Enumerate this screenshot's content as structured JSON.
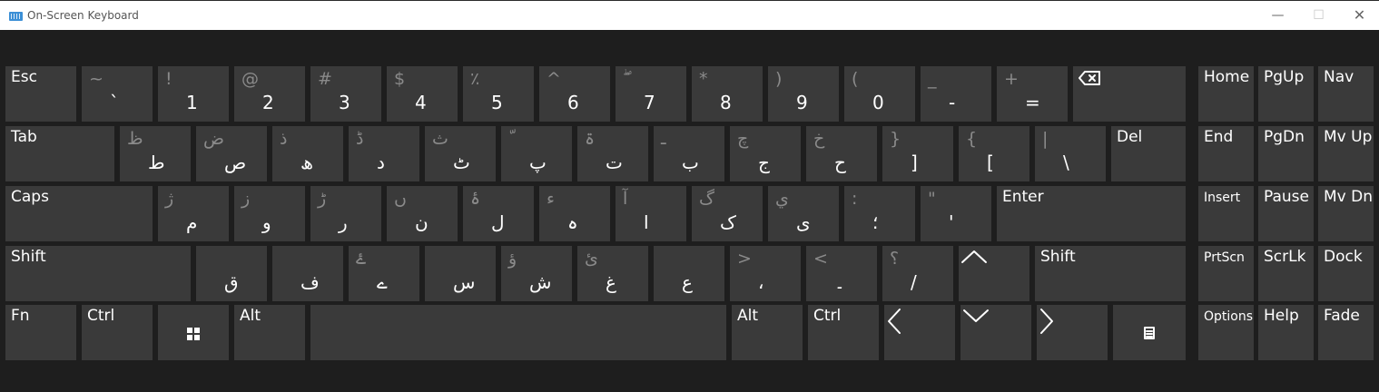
{
  "window": {
    "title": "On-Screen Keyboard",
    "keyboard_icon": "keyboard-icon",
    "minimize": "—",
    "maximize": "☐",
    "close": "✕"
  },
  "rows": [
    [
      {
        "id": "esc",
        "label": "Esc"
      },
      {
        "id": "grave",
        "main": "`",
        "shift": "~"
      },
      {
        "id": "1",
        "main": "1",
        "shift": "!"
      },
      {
        "id": "2",
        "main": "2",
        "shift": "@"
      },
      {
        "id": "3",
        "main": "3",
        "shift": "#"
      },
      {
        "id": "4",
        "main": "4",
        "shift": "$"
      },
      {
        "id": "5",
        "main": "5",
        "shift": "٪"
      },
      {
        "id": "6",
        "main": "6",
        "shift": "^"
      },
      {
        "id": "7",
        "main": "7",
        "shift": "ۖ"
      },
      {
        "id": "8",
        "main": "8",
        "shift": "*"
      },
      {
        "id": "9",
        "main": "9",
        "shift": ")"
      },
      {
        "id": "0",
        "main": "0",
        "shift": "("
      },
      {
        "id": "minus",
        "main": "-",
        "shift": "_"
      },
      {
        "id": "equals",
        "main": "=",
        "shift": "+"
      },
      {
        "id": "backspace",
        "icon": "backspace-icon"
      }
    ],
    [
      {
        "id": "tab",
        "label": "Tab"
      },
      {
        "id": "q",
        "main": "ط",
        "shift": "ظ"
      },
      {
        "id": "w",
        "main": "ص",
        "shift": "ض"
      },
      {
        "id": "e",
        "main": "ھ",
        "shift": "ذ"
      },
      {
        "id": "r",
        "main": "د",
        "shift": "ڈ"
      },
      {
        "id": "t",
        "main": "ٹ",
        "shift": "ث"
      },
      {
        "id": "y",
        "main": "پ",
        "shift": "ّ"
      },
      {
        "id": "u",
        "main": "ت",
        "shift": "ۃ"
      },
      {
        "id": "i",
        "main": "ب",
        "shift": "ـ"
      },
      {
        "id": "o",
        "main": "ج",
        "shift": "چ"
      },
      {
        "id": "p",
        "main": "ح",
        "shift": "خ"
      },
      {
        "id": "lbracket",
        "main": "]",
        "shift": "}"
      },
      {
        "id": "rbracket",
        "main": "[",
        "shift": "{"
      },
      {
        "id": "backslash",
        "main": "\\",
        "shift": "|"
      },
      {
        "id": "del",
        "label": "Del"
      }
    ],
    [
      {
        "id": "caps",
        "label": "Caps"
      },
      {
        "id": "a",
        "main": "م",
        "shift": "ژ"
      },
      {
        "id": "s",
        "main": "و",
        "shift": "ز"
      },
      {
        "id": "d",
        "main": "ر",
        "shift": "ڑ"
      },
      {
        "id": "f",
        "main": "ن",
        "shift": "ں"
      },
      {
        "id": "g",
        "main": "ل",
        "shift": "ۂ"
      },
      {
        "id": "h",
        "main": "ہ",
        "shift": "ء"
      },
      {
        "id": "j",
        "main": "ا",
        "shift": "آ"
      },
      {
        "id": "k",
        "main": "ک",
        "shift": "گ"
      },
      {
        "id": "l",
        "main": "ی",
        "shift": "ي"
      },
      {
        "id": "semicolon",
        "main": "؛",
        "shift": ":"
      },
      {
        "id": "quote",
        "main": "'",
        "shift": "\""
      },
      {
        "id": "enter",
        "label": "Enter"
      }
    ],
    [
      {
        "id": "lshift",
        "label": "Shift"
      },
      {
        "id": "z",
        "main": "ق",
        "shift": ""
      },
      {
        "id": "x",
        "main": "ف",
        "shift": ""
      },
      {
        "id": "c",
        "main": "ے",
        "shift": "ۓ"
      },
      {
        "id": "v",
        "main": "س",
        "shift": ""
      },
      {
        "id": "b",
        "main": "ش",
        "shift": "ؤ"
      },
      {
        "id": "n",
        "main": "غ",
        "shift": "ئ"
      },
      {
        "id": "m",
        "main": "ع",
        "shift": ""
      },
      {
        "id": "comma",
        "main": "،",
        "shift": ">"
      },
      {
        "id": "period",
        "main": "۔",
        "shift": "<"
      },
      {
        "id": "slash",
        "main": "/",
        "shift": "؟"
      },
      {
        "id": "up",
        "icon": "arrow-up-icon"
      },
      {
        "id": "rshift",
        "label": "Shift"
      }
    ],
    [
      {
        "id": "fn",
        "label": "Fn"
      },
      {
        "id": "lctrl",
        "label": "Ctrl"
      },
      {
        "id": "win",
        "icon": "windows-icon"
      },
      {
        "id": "lalt",
        "label": "Alt"
      },
      {
        "id": "space",
        "label": ""
      },
      {
        "id": "ralt",
        "label": "Alt"
      },
      {
        "id": "rctrl",
        "label": "Ctrl"
      },
      {
        "id": "left",
        "icon": "arrow-left-icon"
      },
      {
        "id": "down",
        "icon": "arrow-down-icon"
      },
      {
        "id": "right",
        "icon": "arrow-right-icon"
      },
      {
        "id": "menu",
        "icon": "context-menu-icon"
      }
    ]
  ],
  "right_cluster": [
    [
      {
        "id": "home",
        "label": "Home"
      },
      {
        "id": "pgup",
        "label": "PgUp"
      },
      {
        "id": "nav",
        "label": "Nav"
      }
    ],
    [
      {
        "id": "end",
        "label": "End"
      },
      {
        "id": "pgdn",
        "label": "PgDn"
      },
      {
        "id": "mvup",
        "label": "Mv Up"
      }
    ],
    [
      {
        "id": "insert",
        "label": "Insert"
      },
      {
        "id": "pause",
        "label": "Pause"
      },
      {
        "id": "mvdn",
        "label": "Mv Dn"
      }
    ],
    [
      {
        "id": "prtscn",
        "label": "PrtScn"
      },
      {
        "id": "scrlk",
        "label": "ScrLk"
      },
      {
        "id": "dock",
        "label": "Dock"
      }
    ],
    [
      {
        "id": "options",
        "label": "Options"
      },
      {
        "id": "help",
        "label": "Help"
      },
      {
        "id": "fade",
        "label": "Fade"
      }
    ]
  ]
}
